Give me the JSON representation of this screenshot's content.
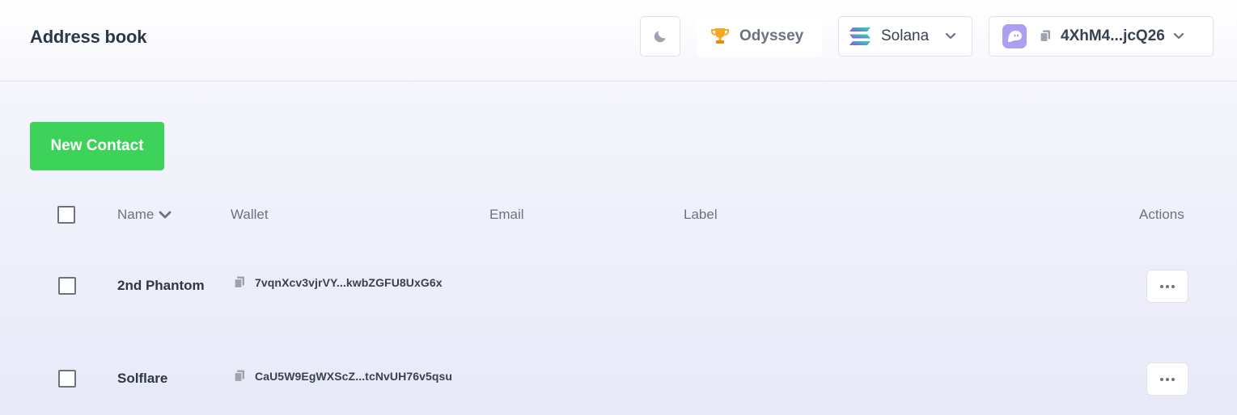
{
  "header": {
    "title": "Address book",
    "theme_icon": "moon-icon",
    "odyssey": {
      "icon": "trophy-icon",
      "label": "Odyssey",
      "color": "#f5a623"
    },
    "network": {
      "icon": "solana-logo-icon",
      "label": "Solana"
    },
    "wallet": {
      "icon": "phantom-ghost-icon",
      "address": "4XhM4...jcQ26",
      "avatar_color": "#ab9ff2"
    }
  },
  "actions": {
    "new_contact_label": "New Contact",
    "new_contact_color": "#3dd35a"
  },
  "table": {
    "columns": {
      "name": "Name",
      "wallet": "Wallet",
      "email": "Email",
      "label": "Label",
      "actions": "Actions"
    },
    "rows": [
      {
        "name": "2nd Phantom",
        "wallet": "7vqnXcv3vjrVY...kwbZGFU8UxG6x",
        "email": "",
        "label": ""
      },
      {
        "name": "Solflare",
        "wallet": "CaU5W9EgWXScZ...tcNvUH76v5qsu",
        "email": "",
        "label": ""
      }
    ]
  }
}
